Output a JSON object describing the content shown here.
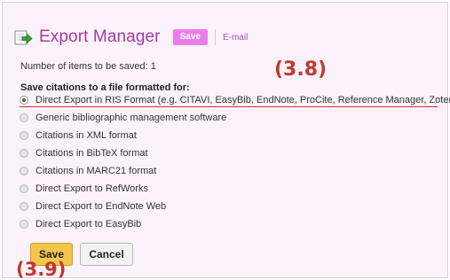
{
  "header": {
    "title": "Export Manager",
    "tabs": {
      "save": "Save",
      "email": "E-mail"
    }
  },
  "count_label": "Number of items to be saved: 1",
  "section_label": "Save citations to a file formatted for:",
  "options": [
    {
      "label": "Direct Export in RIS Format (e.g. CITAVI, EasyBib, EndNote, ProCite, Reference Manager, Zotero)",
      "selected": true
    },
    {
      "label": "Generic bibliographic management software",
      "selected": false
    },
    {
      "label": "Citations in XML format",
      "selected": false
    },
    {
      "label": "Citations in BibTeX format",
      "selected": false
    },
    {
      "label": "Citations in MARC21 format",
      "selected": false
    },
    {
      "label": "Direct Export to RefWorks",
      "selected": false
    },
    {
      "label": "Direct Export to EndNote Web",
      "selected": false
    },
    {
      "label": "Direct Export to EasyBib",
      "selected": false
    }
  ],
  "buttons": {
    "save": "Save",
    "cancel": "Cancel"
  },
  "annotations": {
    "top": "(3.8)",
    "bottom": "(3.9)"
  },
  "colors": {
    "accent": "#ea7dea",
    "title": "#a53aa6",
    "panel_bg": "#fbf2fb",
    "annotation": "#c0392b",
    "save_button": "#f3c54b"
  }
}
